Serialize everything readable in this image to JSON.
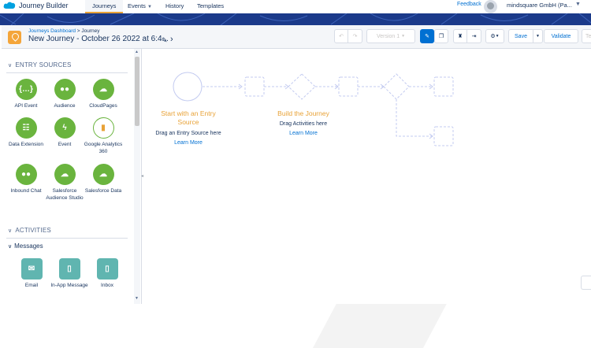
{
  "topnav": {
    "app_name": "Journey Builder",
    "tabs": [
      {
        "label": "Journeys",
        "active": true
      },
      {
        "label": "Events",
        "has_menu": true
      },
      {
        "label": "History"
      },
      {
        "label": "Templates"
      }
    ],
    "feedback": "Feedback",
    "org": "mindsquare GmbH (Pa..."
  },
  "header": {
    "breadcrumb_parent": "Journeys Dashboard",
    "breadcrumb_sep": ">",
    "breadcrumb_current": "Journey",
    "title": "New Journey - October 26 2022 at 6:4...",
    "version": "Version 1",
    "save": "Save",
    "validate": "Validate",
    "test_partial": "Te"
  },
  "sidebar": {
    "entry_sources_heading": "ENTRY SOURCES",
    "entry_sources": [
      {
        "label": "API Event",
        "icon": "api-braces-icon"
      },
      {
        "label": "Audience",
        "icon": "audience-group-icon"
      },
      {
        "label": "CloudPages",
        "icon": "cloudpages-icon"
      },
      {
        "label": "Data Extension",
        "icon": "data-extension-table-icon"
      },
      {
        "label": "Event",
        "icon": "event-bolt-icon"
      },
      {
        "label": "Google Analytics 360",
        "icon": "analytics-bars-icon"
      },
      {
        "label": "Inbound Chat",
        "icon": "chat-bubbles-icon"
      },
      {
        "label": "Salesforce Audience Studio",
        "icon": "salesforce-cloud-icon"
      },
      {
        "label": "Salesforce Data",
        "icon": "salesforce-data-icon"
      }
    ],
    "activities_heading": "ACTIVITIES",
    "messages_heading": "Messages",
    "messages": [
      {
        "label": "Email",
        "icon": "envelope-icon"
      },
      {
        "label": "In-App Message",
        "icon": "phone-message-icon"
      },
      {
        "label": "Inbox",
        "icon": "phone-inbox-icon"
      }
    ]
  },
  "canvas": {
    "entry_heading": "Start with an Entry Source",
    "entry_text": "Drag an Entry Source here",
    "entry_link": "Learn More",
    "build_heading": "Build the Journey",
    "build_text": "Drag Activities here",
    "build_link": "Learn More"
  },
  "colors": {
    "accent_orange": "#e8a237",
    "brand_blue": "#0070d2",
    "entry_green": "#6ab43e",
    "message_teal": "#60b5b0",
    "banner_navy": "#1b3a8a"
  }
}
